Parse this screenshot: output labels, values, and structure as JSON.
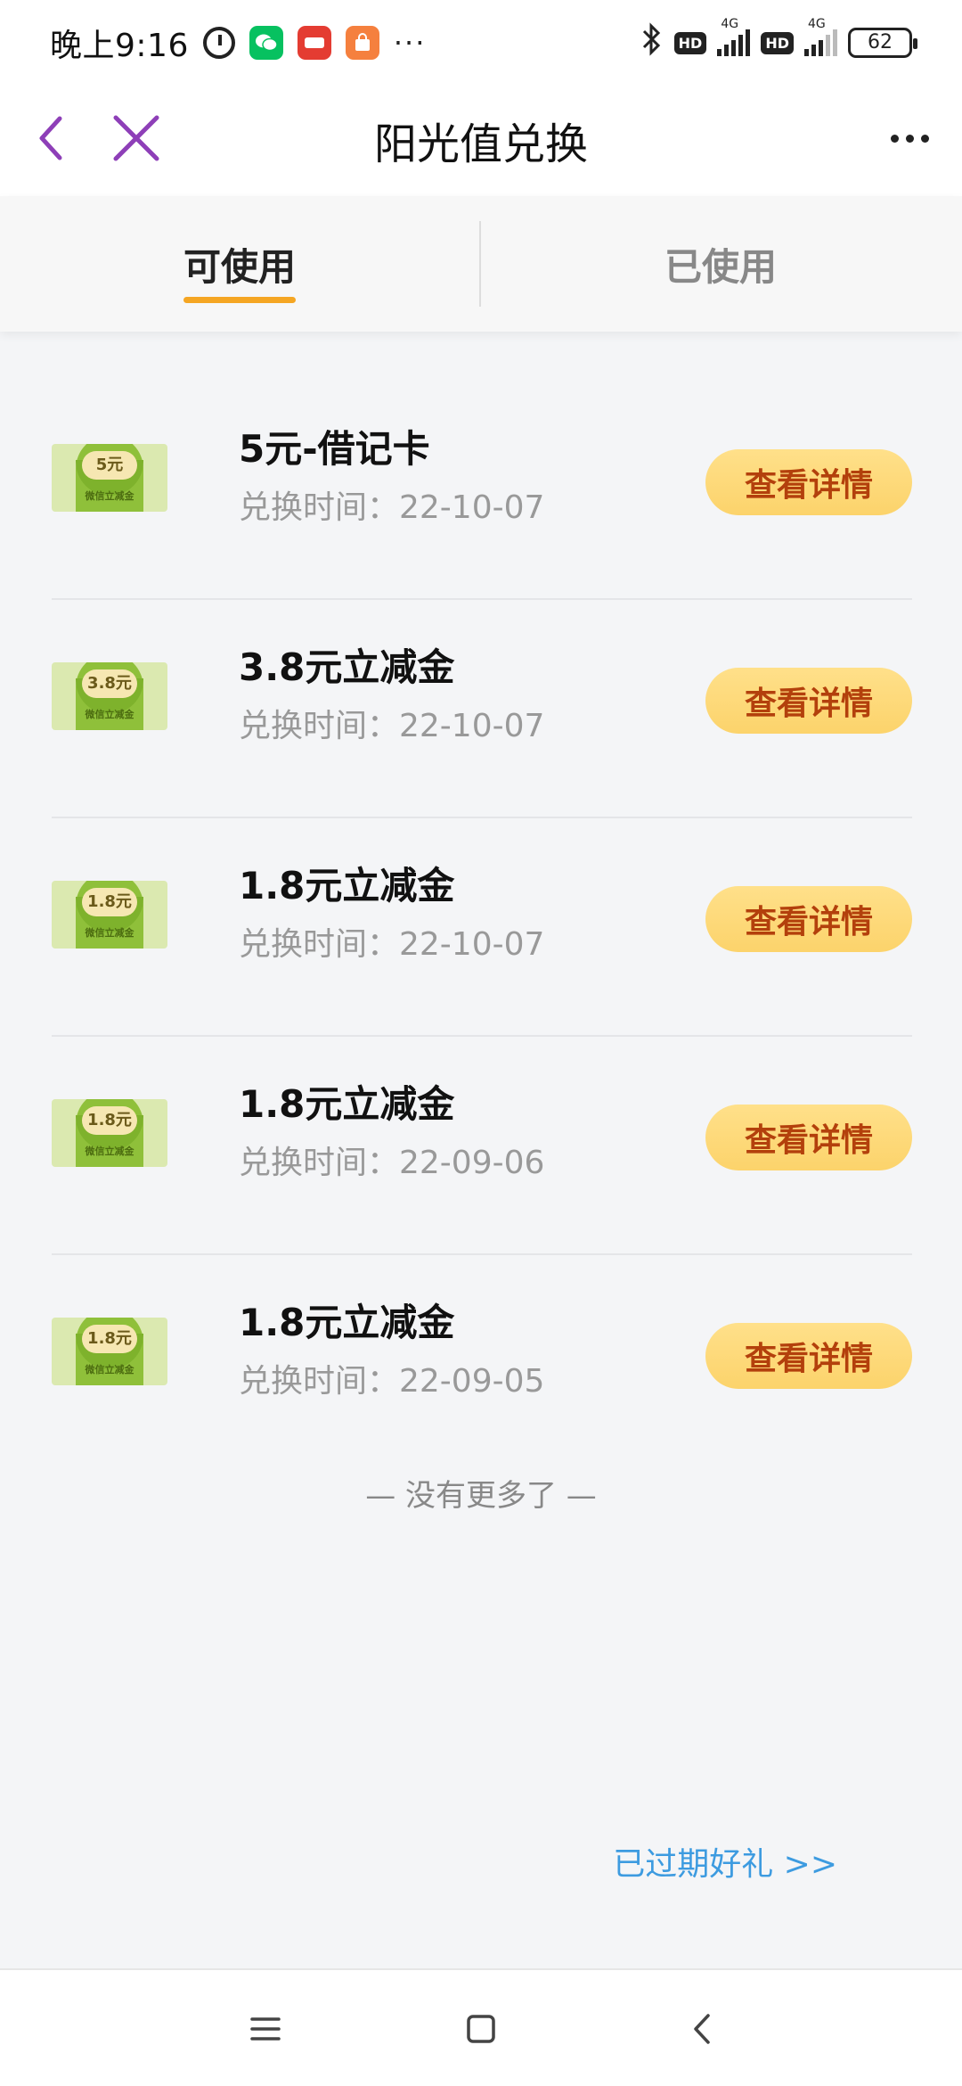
{
  "status_bar": {
    "time": "晚上9:16",
    "more": "···",
    "network_label": "4G",
    "network_label_2": "4G",
    "hd": "HD",
    "battery": "62"
  },
  "nav": {
    "title": "阳光值兑换"
  },
  "tabs": [
    {
      "label": "可使用",
      "active": true
    },
    {
      "label": "已使用",
      "active": false
    }
  ],
  "items": [
    {
      "badge": "5元",
      "badge_sub": "微信立减金",
      "title": "5元-借记卡",
      "date": "兑换时间：22-10-07",
      "button": "查看详情"
    },
    {
      "badge": "3.8元",
      "badge_sub": "微信立减金",
      "title": "3.8元立减金",
      "date": "兑换时间：22-10-07",
      "button": "查看详情"
    },
    {
      "badge": "1.8元",
      "badge_sub": "微信立减金",
      "title": "1.8元立减金",
      "date": "兑换时间：22-10-07",
      "button": "查看详情"
    },
    {
      "badge": "1.8元",
      "badge_sub": "微信立减金",
      "title": "1.8元立减金",
      "date": "兑换时间：22-09-06",
      "button": "查看详情"
    },
    {
      "badge": "1.8元",
      "badge_sub": "微信立减金",
      "title": "1.8元立减金",
      "date": "兑换时间：22-09-05",
      "button": "查看详情"
    }
  ],
  "no_more_text": "— 没有更多了 —",
  "expired_link": "已过期好礼 >>",
  "colors": {
    "accent": "#f5a623",
    "button_bg": "#fcd36b",
    "button_text": "#b3400c",
    "link": "#3d9be0",
    "nav_icon": "#8e3fb8"
  },
  "icons": {
    "back": "chevron-left-icon",
    "close": "close-icon",
    "more": "more-dots-icon",
    "menu": "menu-icon",
    "home": "home-square-icon",
    "sys_back": "back-icon"
  }
}
